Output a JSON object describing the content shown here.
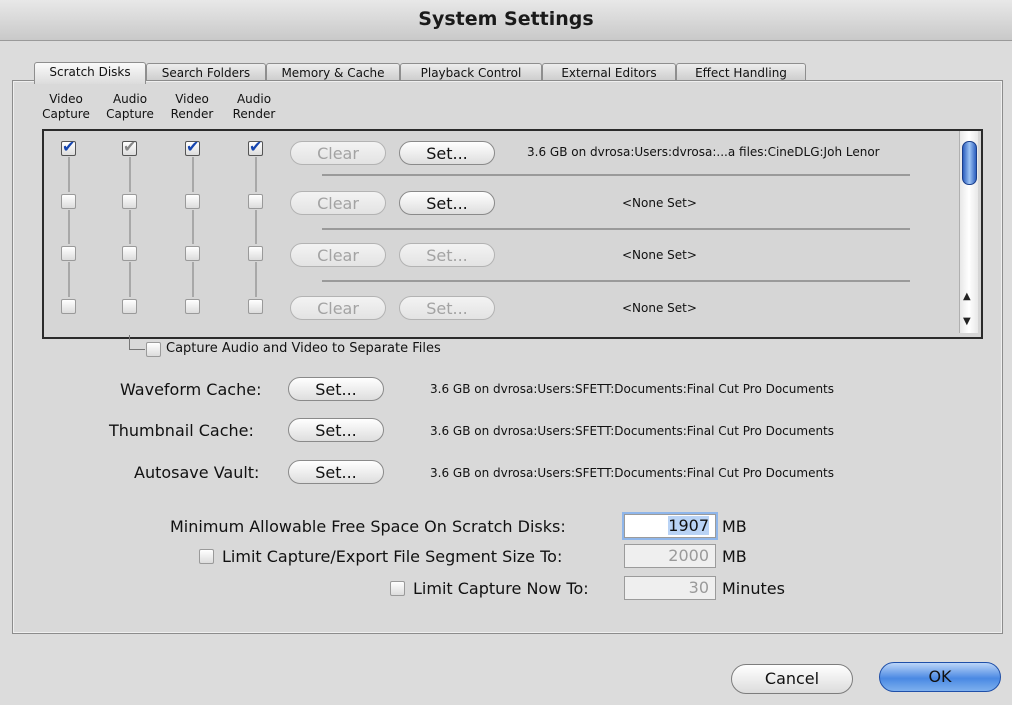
{
  "window": {
    "title": "System Settings"
  },
  "tabs": [
    "Scratch Disks",
    "Search Folders",
    "Memory & Cache",
    "Playback Control",
    "External Editors",
    "Effect Handling"
  ],
  "columns": {
    "video_capture": [
      "Video",
      "Capture"
    ],
    "audio_capture": [
      "Audio",
      "Capture"
    ],
    "video_render": [
      "Video",
      "Render"
    ],
    "audio_render": [
      "Audio",
      "Render"
    ]
  },
  "disk_rows": [
    {
      "video_capture": true,
      "audio_capture": true,
      "video_render": true,
      "audio_render": true,
      "clear_label": "Clear",
      "set_label": "Set...",
      "path": "3.6 GB on  dvrosa:Users:dvrosa:...a files:CineDLG:Joh Lenor"
    },
    {
      "video_capture": false,
      "audio_capture": false,
      "video_render": false,
      "audio_render": false,
      "clear_label": "Clear",
      "set_label": "Set...",
      "path": "<None Set>"
    },
    {
      "video_capture": false,
      "audio_capture": false,
      "video_render": false,
      "audio_render": false,
      "clear_label": "Clear",
      "set_label": "Set...",
      "path": "<None Set>"
    },
    {
      "video_capture": false,
      "audio_capture": false,
      "video_render": false,
      "audio_render": false,
      "clear_label": "Clear",
      "set_label": "Set...",
      "path": "<None Set>"
    }
  ],
  "separate_files": {
    "label": "Capture Audio and Video to Separate Files",
    "checked": false
  },
  "caches": {
    "waveform": {
      "label": "Waveform Cache:",
      "set_label": "Set...",
      "path": "3.6 GB on  dvrosa:Users:SFETT:Documents:Final Cut Pro Documents"
    },
    "thumbnail": {
      "label": "Thumbnail Cache:",
      "set_label": "Set...",
      "path": "3.6 GB on  dvrosa:Users:SFETT:Documents:Final Cut Pro Documents"
    },
    "autosave": {
      "label": "Autosave Vault:",
      "set_label": "Set...",
      "path": "3.6 GB on  dvrosa:Users:SFETT:Documents:Final Cut Pro Documents"
    }
  },
  "limits": {
    "min_free": {
      "label": "Minimum Allowable Free Space On Scratch Disks:",
      "value": "1907",
      "unit": "MB"
    },
    "segment": {
      "label": "Limit Capture/Export File Segment Size To:",
      "value": "2000",
      "unit": "MB",
      "checked": false
    },
    "capture_now": {
      "label": "Limit Capture Now To:",
      "value": "30",
      "unit": "Minutes",
      "checked": false
    }
  },
  "buttons": {
    "cancel": "Cancel",
    "ok": "OK"
  },
  "colors": {
    "accent": "#2d5fbf",
    "checkmark": "#1545b0"
  }
}
